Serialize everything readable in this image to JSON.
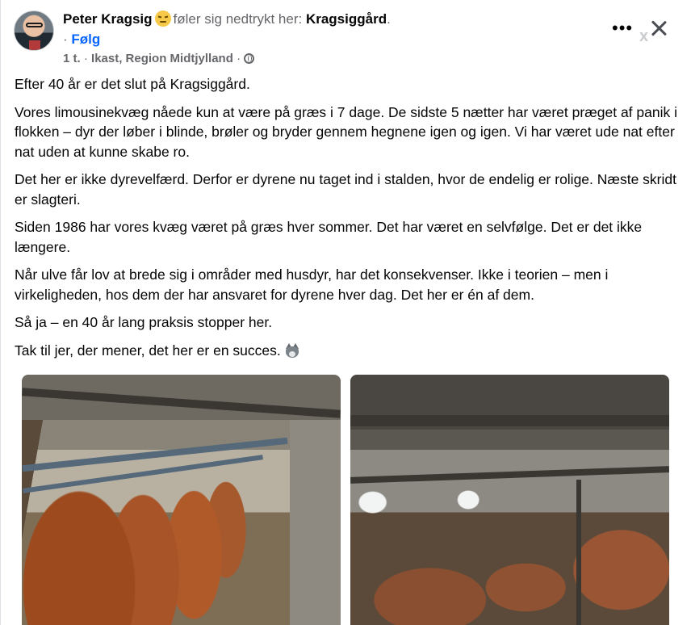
{
  "header": {
    "author_name": "Peter Kragsig",
    "feeling_text": "føler sig nedtrykt her:",
    "place_name": "Kragsiggård",
    "place_suffix": ".",
    "follow_prefix": "·",
    "follow_label": "Følg",
    "time_label": "1 t.",
    "separator": "·",
    "location": "Ikast, Region Midtjylland",
    "separator2": "·",
    "audience_icon": "globe-icon",
    "more_icon": "more-options-icon",
    "more_label": "•••",
    "close_icon": "close-icon",
    "x_mark": "x"
  },
  "post": {
    "paragraphs": [
      "Efter 40 år er det slut på Kragsiggård.",
      "Vores limousinekvæg nåede kun at være på græs i 7 dage. De sidste 5 nætter har været præget af panik i flokken – dyr der løber i blinde, brøler og bryder gennem hegnene igen og igen. Vi har været ude nat efter nat uden at kunne skabe ro.",
      "Det her er ikke dyrevelfærd. Derfor er dyrene nu taget ind i stalden, hvor de endelig er rolige. Næste skridt er slagteri.",
      "Siden 1986 har vores kvæg været på græs hver sommer. Det har været en selvfølge. Det er det ikke længere.",
      "Når ulve får lov at brede sig i områder med husdyr, har det konsekvenser. Ikke i teorien – men i virkeligheden, hos dem der har ansvaret for dyrene hver dag. Det her er én af dem.",
      "Så ja – en 40 år lang praksis stopper her.",
      "Tak til jer, der mener, det her er en succes."
    ],
    "closing_emoji": "wolf-emoji"
  },
  "photos": [
    {
      "name": "photo-cattle-stalls"
    },
    {
      "name": "photo-cattle-barn"
    }
  ]
}
